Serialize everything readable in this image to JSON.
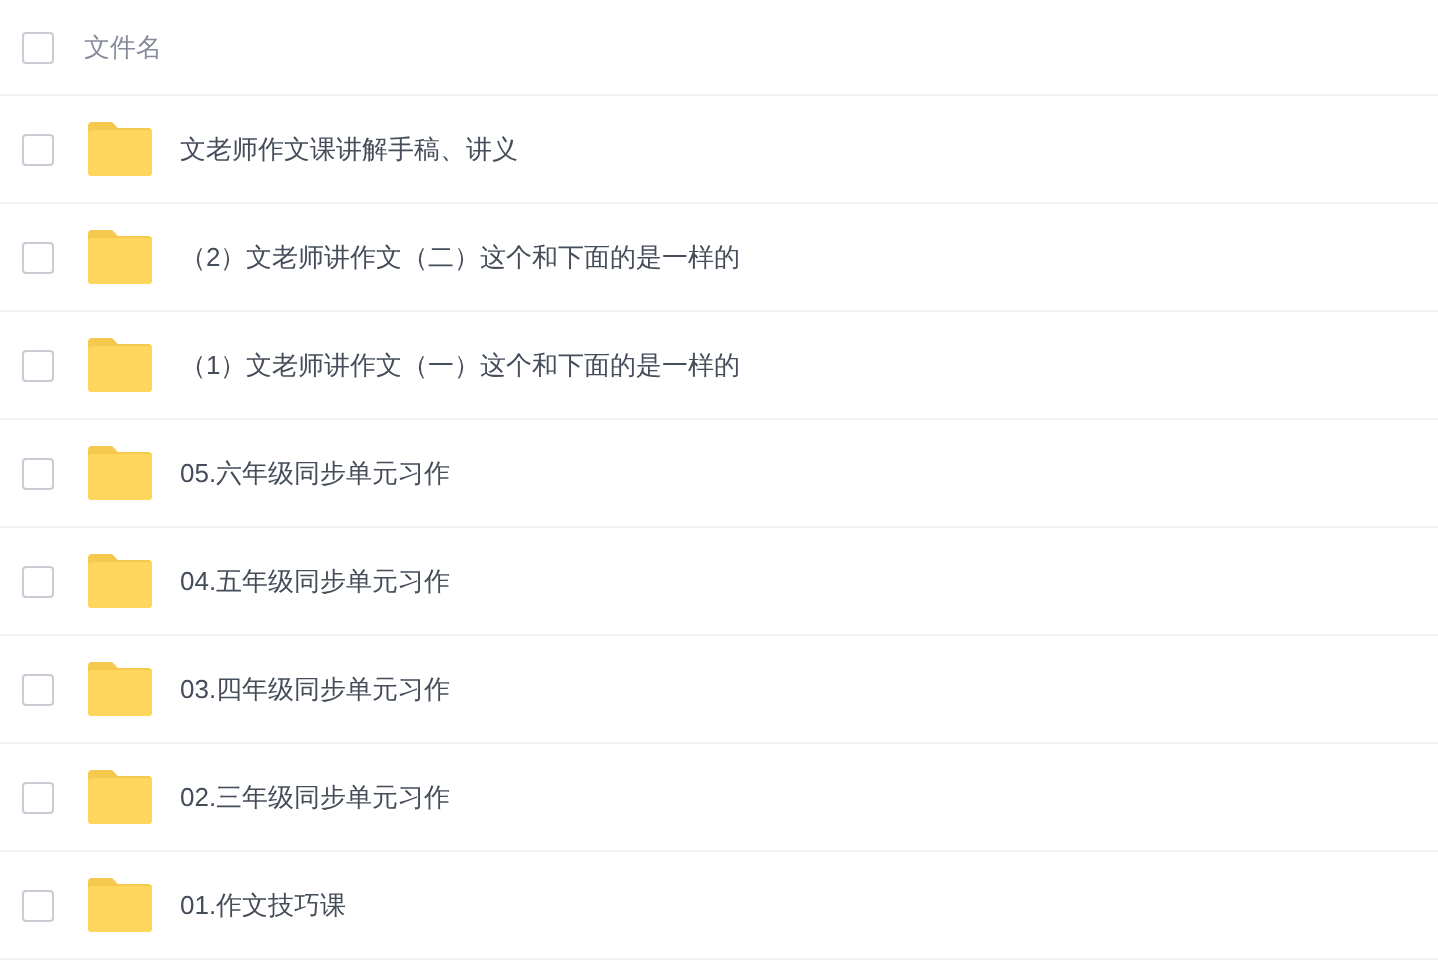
{
  "header": {
    "label": "文件名",
    "checked": false
  },
  "files": [
    {
      "name": "文老师作文课讲解手稿、讲义",
      "checked": false
    },
    {
      "name": "（2）文老师讲作文（二）这个和下面的是一样的",
      "checked": false
    },
    {
      "name": "（1）文老师讲作文（一）这个和下面的是一样的",
      "checked": false
    },
    {
      "name": "05.六年级同步单元习作",
      "checked": false
    },
    {
      "name": "04.五年级同步单元习作",
      "checked": false
    },
    {
      "name": "03.四年级同步单元习作",
      "checked": false
    },
    {
      "name": "02.三年级同步单元习作",
      "checked": false
    },
    {
      "name": "01.作文技巧课",
      "checked": false
    }
  ]
}
